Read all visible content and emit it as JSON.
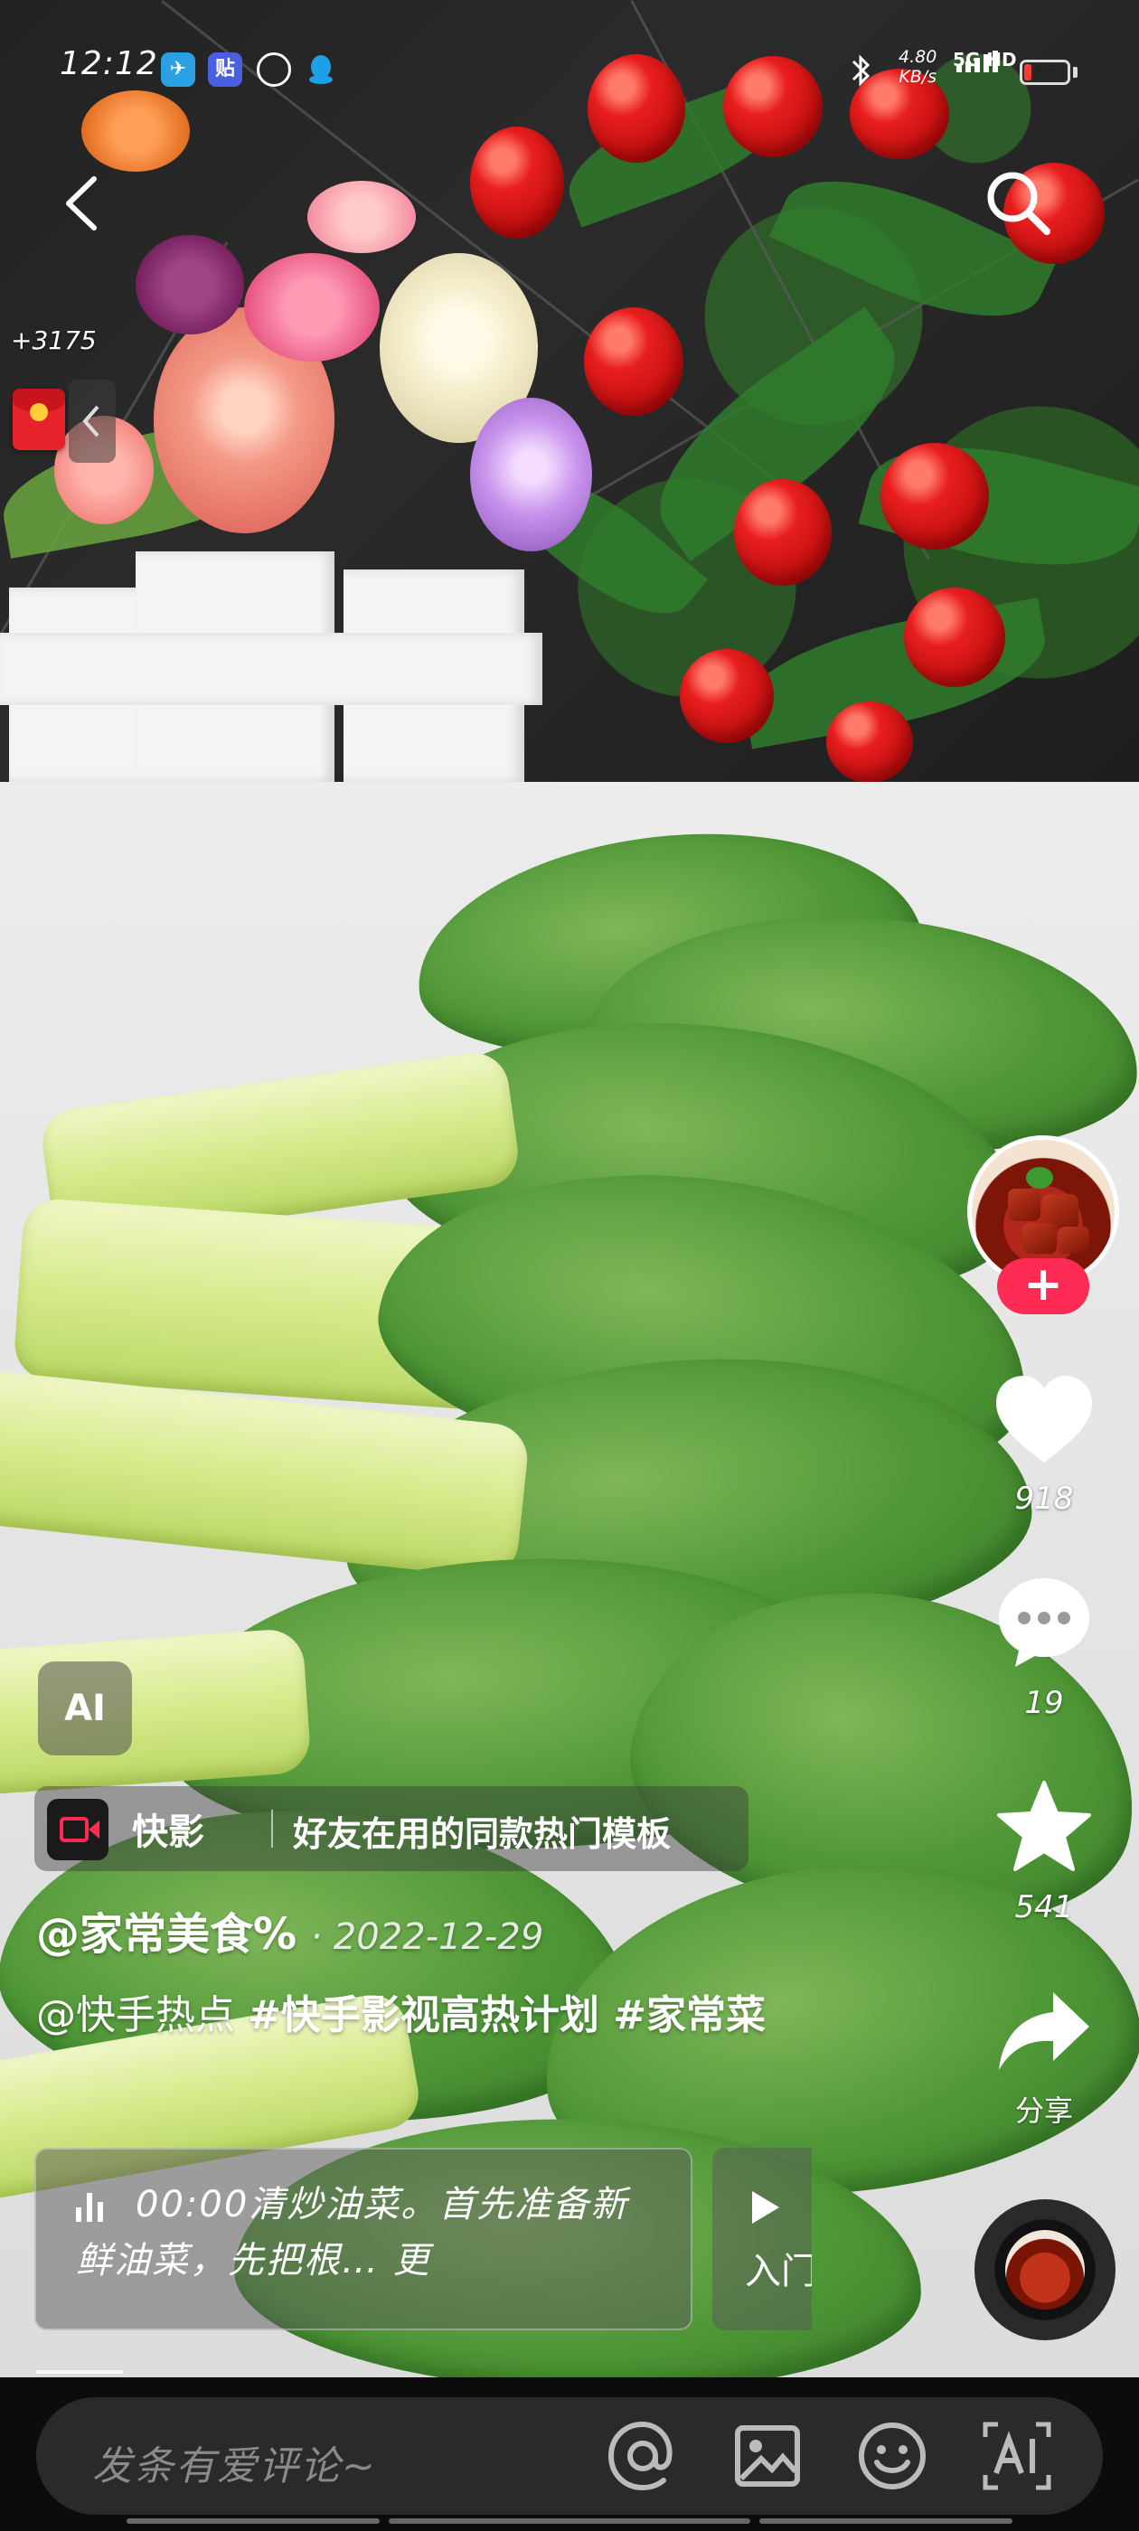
{
  "status_bar": {
    "time": "12:12",
    "net_speed_value": "4.80",
    "net_speed_unit": "KB/s",
    "network": "5G HD",
    "battery": "15",
    "app_icons": [
      "telegram-icon",
      "tieba-icon",
      "app-icon",
      "qq-icon"
    ]
  },
  "overlay": {
    "red_packet_count": "+3175"
  },
  "sidebar": {
    "likes": "918",
    "comments": "19",
    "favorites": "541",
    "share_label": "分享",
    "follow_symbol": "+"
  },
  "ai_badge": "AI",
  "template_banner": {
    "app_name": "快影",
    "text": "好友在用的同款热门模板"
  },
  "post": {
    "author": "@家常美食%",
    "date": "· 2022-12-29",
    "caption_mention": "@快手热点 ",
    "caption_tag1": "#快手影视高热计划",
    "caption_tag2": " #家常菜"
  },
  "chapter": {
    "text": "00:00清炒油菜。首先准备新鲜油菜，先把根… 更",
    "next_label": "入门"
  },
  "comment_bar": {
    "placeholder": "发条有爱评论~"
  },
  "colors": {
    "follow_red": "#fe2c55",
    "battery_low": "#ff3b30",
    "bar_background": "#0c0c0c"
  }
}
